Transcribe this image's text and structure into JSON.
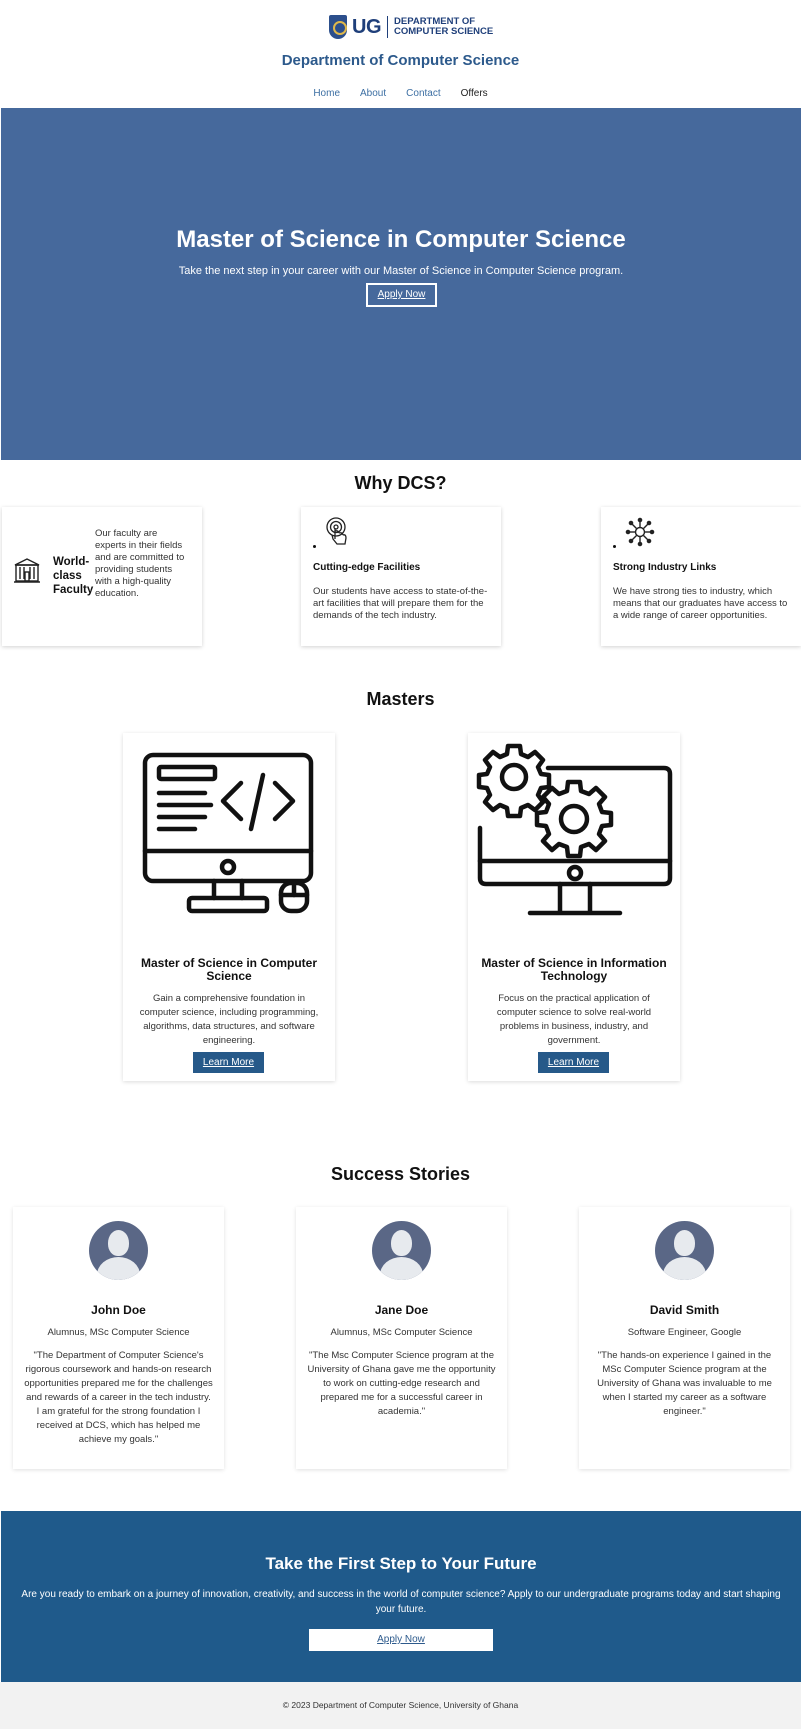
{
  "header": {
    "logo_text": "UG",
    "logo_dept_line1": "DEPARTMENT OF",
    "logo_dept_line2": "COMPUTER SCIENCE",
    "site_title": "Department of Computer Science",
    "nav": [
      {
        "label": "Home"
      },
      {
        "label": "About"
      },
      {
        "label": "Contact"
      },
      {
        "label": "Offers"
      }
    ]
  },
  "hero": {
    "title": "Master of Science in Computer Science",
    "subtitle": "Take the next step in your career with our Master of Science in Computer Science program.",
    "button_label": "Apply Now"
  },
  "why": {
    "title": "Why DCS?",
    "cards": [
      {
        "title": "World-class Faculty",
        "text": "Our faculty are experts in their fields and are committed to providing students with a high-quality education.",
        "icon": "university-building-icon"
      },
      {
        "title": "Cutting-edge Facilities",
        "text": "Our students have access to state-of-the-art facilities that will prepare them for the demands of the tech industry.",
        "icon": "touch-target-icon"
      },
      {
        "title": "Strong Industry Links",
        "text": "We have strong ties to industry, which means that our graduates have access to a wide range of career opportunities.",
        "icon": "network-hub-icon"
      }
    ]
  },
  "masters": {
    "title": "Masters",
    "programs": [
      {
        "title": "Master of Science in Computer Science",
        "text": "Gain a comprehensive foundation in computer science, including programming, algorithms, data structures, and software engineering.",
        "button_label": "Learn More",
        "icon": "code-monitor-icon"
      },
      {
        "title": "Master of Science in Information Technology",
        "text": "Focus on the practical application of computer science to solve real-world problems in business, industry, and government.",
        "button_label": "Learn More",
        "icon": "gears-monitor-icon"
      }
    ]
  },
  "stories": {
    "title": "Success Stories",
    "items": [
      {
        "name": "John Doe",
        "role": "Alumnus, MSc Computer Science",
        "quote": "\"The Department of Computer Science's rigorous coursework and hands-on research opportunities prepared me for the challenges and rewards of a career in the tech industry. I am grateful for the strong foundation I received at DCS, which has helped me achieve my goals.\""
      },
      {
        "name": "Jane Doe",
        "role": "Alumnus, MSc Computer Science",
        "quote": "\"The Msc Computer Science program at the University of Ghana gave me the opportunity to work on cutting-edge research and prepared me for a successful career in academia.\""
      },
      {
        "name": "David Smith",
        "role": "Software Engineer, Google",
        "quote": "\"The hands-on experience I gained in the MSc Computer Science program at the University of Ghana was invaluable to me when I started my career as a software engineer.\""
      }
    ]
  },
  "cta": {
    "title": "Take the First Step to Your Future",
    "text": "Are you ready to embark on a journey of innovation, creativity, and success in the world of computer science? Apply to our undergraduate programs today and start shaping your future.",
    "button_label": "Apply Now"
  },
  "footer": {
    "text": "© 2023 Department of Computer Science, University of Ghana"
  },
  "colors": {
    "hero_bg": "#46699c",
    "cta_bg": "#1f5a8b",
    "button_bg": "#265989",
    "brand_blue": "#1f3f7a"
  }
}
